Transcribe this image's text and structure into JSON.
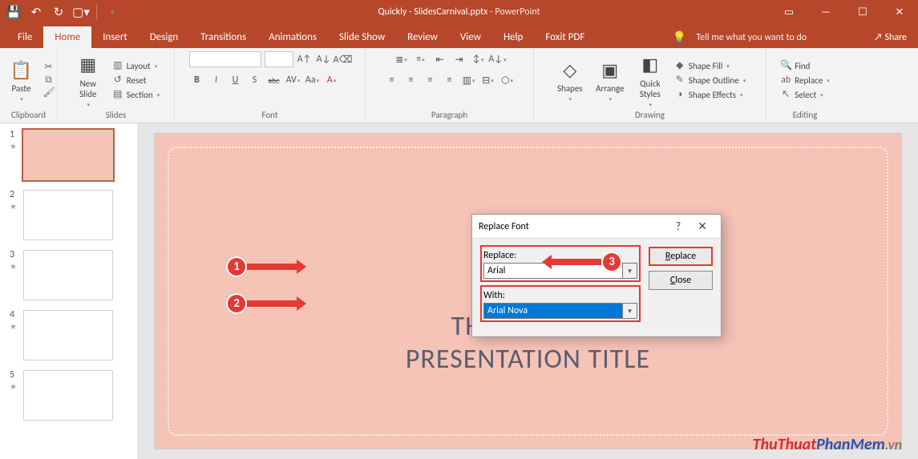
{
  "title": {
    "doc": "Quickly - SlidesCarnival.pptx",
    "sep": " - ",
    "app": "PowerPoint"
  },
  "tabs": {
    "file": "File",
    "home": "Home",
    "insert": "Insert",
    "design": "Design",
    "transitions": "Transitions",
    "animations": "Animations",
    "slideshow": "Slide Show",
    "review": "Review",
    "view": "View",
    "help": "Help",
    "foxit": "Foxit PDF",
    "tell": "Tell me what you want to do",
    "share": "Share"
  },
  "ribbon": {
    "clipboard": {
      "paste": "Paste",
      "label": "Clipboard"
    },
    "slides": {
      "newslide": "New\nSlide",
      "layout": "Layout",
      "reset": "Reset",
      "section": "Section",
      "label": "Slides"
    },
    "font": {
      "label": "Font",
      "bold": "B",
      "italic": "I",
      "underline": "U",
      "shadow": "S",
      "strike": "abc",
      "spacing": "AV",
      "case": "Aa",
      "clear": "A"
    },
    "paragraph": {
      "label": "Paragraph"
    },
    "drawing": {
      "shapes": "Shapes",
      "arrange": "Arrange",
      "quick": "Quick\nStyles",
      "fill": "Shape Fill",
      "outline": "Shape Outline",
      "effects": "Shape Effects",
      "label": "Drawing"
    },
    "editing": {
      "find": "Find",
      "replace": "Replace",
      "select": "Select",
      "label": "Editing"
    }
  },
  "slides_panel": {
    "numbers": [
      "1",
      "2",
      "3",
      "4",
      "5"
    ]
  },
  "slide": {
    "title_line1": "THIS IS YOUR",
    "title_line2": "PRESENTATION TITLE"
  },
  "dialog": {
    "title": "Replace Font",
    "replace_lbl": "Replace:",
    "replace_val": "Arial",
    "with_lbl": "With:",
    "with_val": "Arial Nova",
    "btn_replace_pre": "R",
    "btn_replace_rest": "eplace",
    "btn_close_pre": "C",
    "btn_close_rest": "lose"
  },
  "callouts": {
    "one": "1",
    "two": "2",
    "three": "3"
  },
  "watermark": {
    "a": "ThuThuat",
    "b": "PhanMem",
    "c": ".vn"
  }
}
